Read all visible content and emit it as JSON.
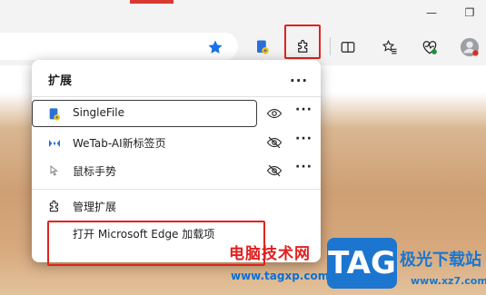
{
  "window": {
    "minimize": "—",
    "restore": "❐"
  },
  "toolbar": {
    "favorite_icon": "star-icon",
    "extensions_icon": "puzzle-icon"
  },
  "extensions_popup": {
    "title": "扩展",
    "more": "···",
    "items": [
      {
        "name": "SingleFile",
        "icon": "singlefile-icon",
        "visibility": "shown"
      },
      {
        "name": "WeTab-AI新标签页",
        "icon": "wetab-icon",
        "visibility": "hidden"
      },
      {
        "name": "鼠标手势",
        "icon": "mouse-gesture-icon",
        "visibility": "hidden"
      }
    ],
    "manage_label": "管理扩展",
    "open_addons_label": "打开 Microsoft Edge 加载项"
  },
  "watermark": {
    "site_name": "电脑技术网",
    "site_url": "www.tagxp.com",
    "logo_text": "TAG",
    "brand": "极光下载站",
    "brand_url": "www.xz7.com"
  },
  "colors": {
    "highlight": "#e0231b",
    "accent": "#1c76cf"
  }
}
